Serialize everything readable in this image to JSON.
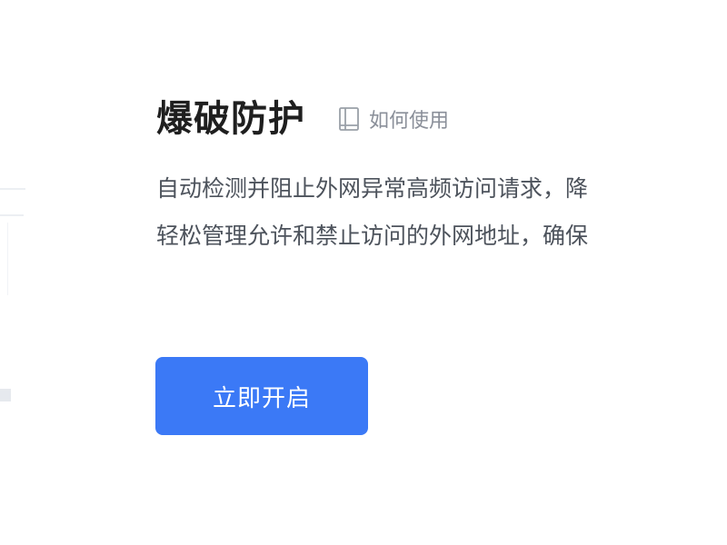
{
  "main": {
    "title": "爆破防护",
    "help_link": {
      "label": "如何使用",
      "icon": "book-icon"
    },
    "description_lines": [
      "自动检测并阻止外网异常高频访问请求，降",
      "轻松管理允许和禁止访问的外网地址，确保"
    ],
    "enable_button_label": "立即开启"
  },
  "colors": {
    "primary": "#3b79f6",
    "title": "#1f1f1f",
    "text": "#4d535c",
    "muted": "#8a8f99"
  }
}
